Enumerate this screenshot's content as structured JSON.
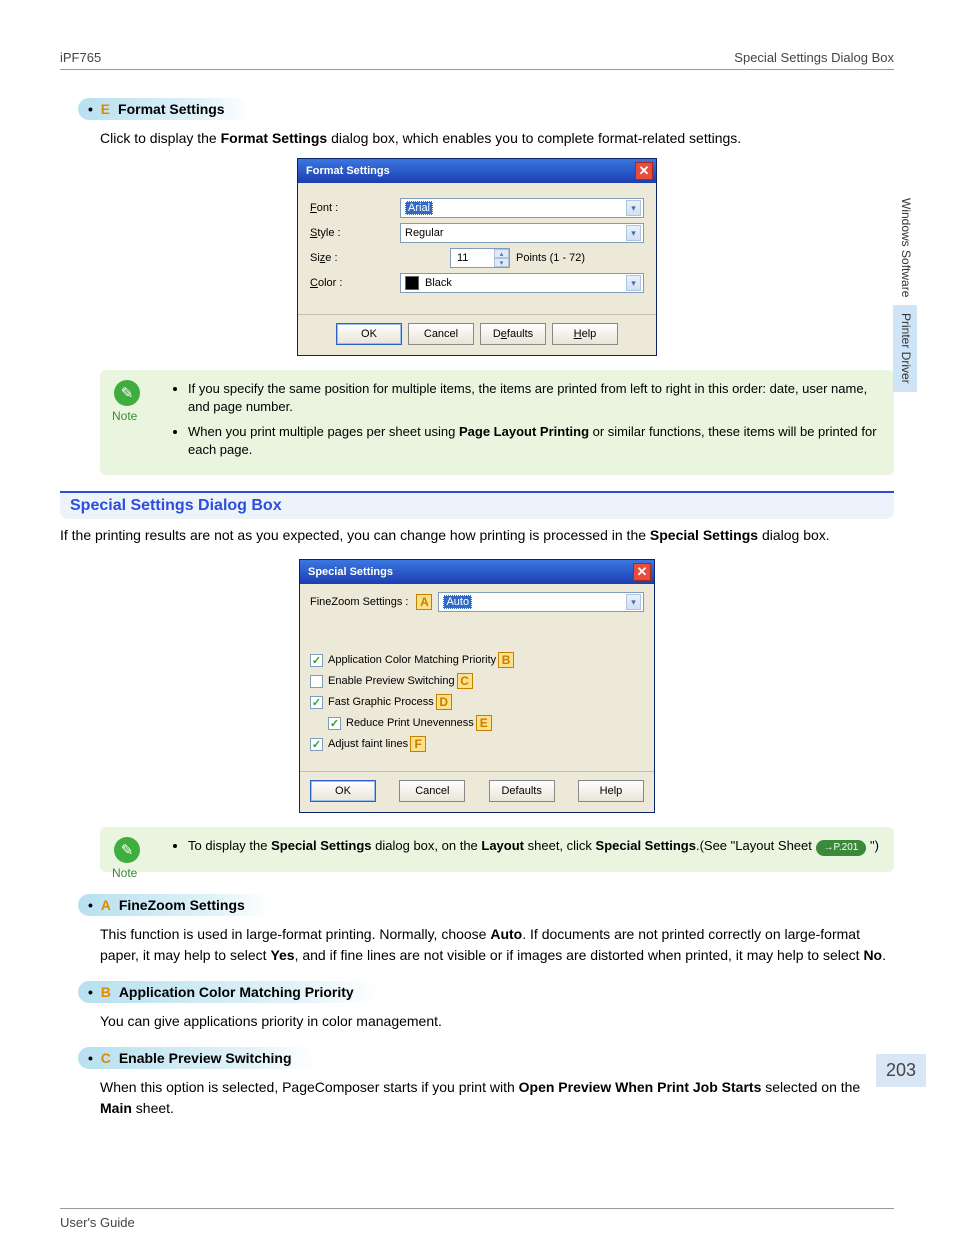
{
  "header": {
    "left": "iPF765",
    "right": "Special Settings Dialog Box"
  },
  "sideTabs": {
    "a": "Windows Software",
    "b": "Printer Driver"
  },
  "letterE": {
    "bullet": "•",
    "letter": "E",
    "title": "Format Settings",
    "desc_pre": "Click to display the ",
    "desc_bold": "Format Settings",
    "desc_post": " dialog box, which enables you to complete format-related settings."
  },
  "fmtDlg": {
    "title": "Format Settings",
    "font_lbl": "Font :",
    "font_val": "Arial",
    "style_lbl": "Style :",
    "style_val": "Regular",
    "size_lbl": "Size :",
    "size_val": "11",
    "size_units": "Points (1 - 72)",
    "color_lbl": "Color :",
    "color_val": "Black",
    "ok": "OK",
    "cancel": "Cancel",
    "defaults": "Defaults",
    "help": "Help"
  },
  "note1": {
    "label": "Note",
    "li1": "If you specify the same position for multiple items, the items are printed from left to right in this order: date, user name, and page number.",
    "li2_a": "When you print multiple pages per sheet using ",
    "li2_b": "Page Layout Printing",
    "li2_c": " or similar functions, these items will be printed for each page."
  },
  "section2": {
    "title": "Special Settings Dialog Box",
    "desc_a": "If the printing results are not as you expected, you can change how printing is processed in the ",
    "desc_b": "Special Settings",
    "desc_c": " dialog box."
  },
  "ssDlg": {
    "title": "Special Settings",
    "fz_lbl": "FineZoom Settings :",
    "fz_tag": "A",
    "fz_val": "Auto",
    "cb1": "Application Color Matching Priority",
    "cb1_tag": "B",
    "cb1_chk": true,
    "cb2": "Enable Preview Switching",
    "cb2_tag": "C",
    "cb2_chk": false,
    "cb3": "Fast Graphic Process",
    "cb3_tag": "D",
    "cb3_chk": true,
    "cb4": "Reduce Print Unevenness",
    "cb4_tag": "E",
    "cb4_chk": true,
    "cb5": "Adjust faint lines",
    "cb5_tag": "F",
    "cb5_chk": true,
    "ok": "OK",
    "cancel": "Cancel",
    "defaults": "Defaults",
    "help": "Help"
  },
  "note2": {
    "label": "Note",
    "a": "To display the ",
    "b": "Special Settings",
    "c": " dialog box, on the ",
    "d": "Layout",
    "e": " sheet, click ",
    "f": "Special Settings",
    "g": ".(See \"Layout Sheet ",
    "ref": "→P.201",
    "h": " \")"
  },
  "letterA": {
    "bullet": "•",
    "letter": "A",
    "title": "FineZoom Settings",
    "p1": "This function is used in large-format printing. Normally, choose ",
    "b1": "Auto",
    "p2": ". If documents are not printed correctly on large-format paper, it may help to select ",
    "b2": "Yes",
    "p3": ", and if fine lines are not visible or if images are distorted when printed, it may help to select ",
    "b3": "No",
    "p4": "."
  },
  "letterB": {
    "bullet": "•",
    "letter": "B",
    "title": "Application Color Matching Priority",
    "p": "You can give applications priority in color management."
  },
  "letterC": {
    "bullet": "•",
    "letter": "C",
    "title": "Enable Preview Switching",
    "p1": "When this option is selected, PageComposer starts if you print with ",
    "b1": "Open Preview When Print Job Starts",
    "p2": " selected on the ",
    "b2": "Main",
    "p3": " sheet."
  },
  "footer": {
    "left": "User's Guide",
    "right": ""
  },
  "pageNum": "203"
}
